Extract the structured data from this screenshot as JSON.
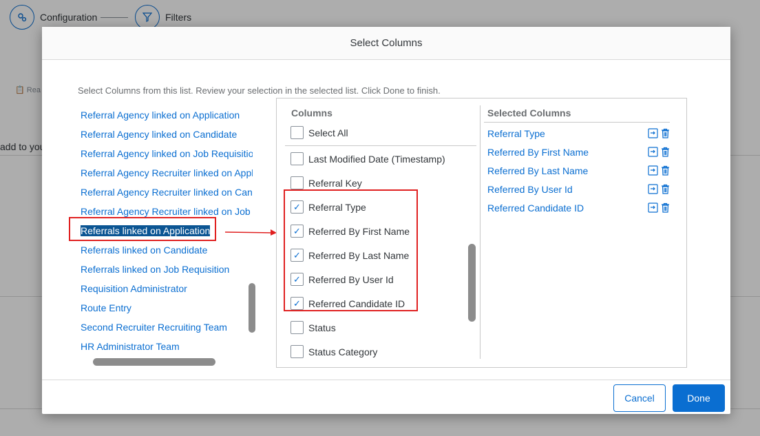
{
  "background": {
    "steps": [
      {
        "label": "Configuration",
        "icon": "gear-icon"
      },
      {
        "label": "Filters",
        "icon": "filter-icon"
      }
    ],
    "read_label": "Rea",
    "add_to_label": "add to you"
  },
  "dialog": {
    "title": "Select Columns",
    "instruction": "Select Columns from this list. Review your selection in the selected list. Click Done to finish.",
    "available_groups": [
      "Referral Agency linked on Application",
      "Referral Agency linked on Candidate",
      "Referral Agency linked on Job Requisition",
      "Referral Agency Recruiter linked on Application",
      "Referral Agency Recruiter linked on Candidate",
      "Referral Agency Recruiter linked on Job Requisition",
      "Referrals linked on Application",
      "Referrals linked on Candidate",
      "Referrals linked on Job Requisition",
      "Requisition Administrator",
      "Route Entry",
      "Second Recruiter Recruiting Team",
      "HR Administrator Team"
    ],
    "selected_group_index": 6,
    "columns_title": "Columns",
    "select_all_label": "Select All",
    "columns": [
      {
        "label": "Last Modified Date (Timestamp)",
        "checked": false
      },
      {
        "label": "Referral Key",
        "checked": false
      },
      {
        "label": "Referral Type",
        "checked": true
      },
      {
        "label": "Referred By First Name",
        "checked": true
      },
      {
        "label": "Referred By Last Name",
        "checked": true
      },
      {
        "label": "Referred By User Id",
        "checked": true
      },
      {
        "label": "Referred Candidate ID",
        "checked": true
      },
      {
        "label": "Status",
        "checked": false
      },
      {
        "label": "Status Category",
        "checked": false
      }
    ],
    "selected_columns_title": "Selected Columns",
    "selected_columns": [
      "Referral Type",
      "Referred By First Name",
      "Referred By Last Name",
      "Referred By User Id",
      "Referred Candidate ID"
    ],
    "cancel_label": "Cancel",
    "done_label": "Done"
  },
  "colors": {
    "accent": "#0a6ed1",
    "selection": "#0b5593",
    "annotation": "#e02020"
  }
}
